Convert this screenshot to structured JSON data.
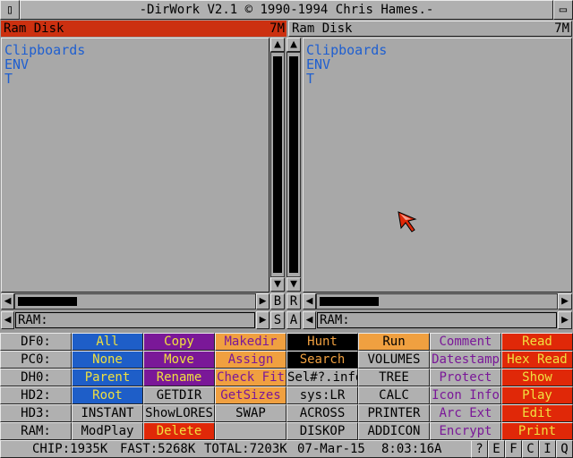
{
  "window": {
    "title": "-DirWork V2.1 © 1990-1994 Chris Hames.-",
    "left_gadget": "▯",
    "right_gadget": "▭"
  },
  "left": {
    "header": "Ram Disk",
    "size": "7M",
    "files": [
      "Clipboards",
      "ENV",
      "T"
    ],
    "path": "RAM:",
    "header_color": "#cc3010"
  },
  "right": {
    "header": "Ram Disk",
    "size": "7M",
    "files": [
      "Clipboards",
      "ENV",
      "T"
    ],
    "path": "RAM:"
  },
  "middle": {
    "b": "B",
    "r": "R",
    "s": "S",
    "a": "A"
  },
  "buttons": [
    [
      {
        "label": "DF0:",
        "bg": "#b0b0b0",
        "fg": "#000000"
      },
      {
        "label": "All",
        "bg": "#1e5ec8",
        "fg": "#f0e040"
      },
      {
        "label": "Copy",
        "bg": "#7a1898",
        "fg": "#f0e040"
      },
      {
        "label": "Makedir",
        "bg": "#f0a040",
        "fg": "#7a1898"
      },
      {
        "label": "Hunt",
        "bg": "#000000",
        "fg": "#f0a040"
      },
      {
        "label": "Run",
        "bg": "#f0a040",
        "fg": "#000000"
      },
      {
        "label": "Comment",
        "bg": "#b0b0b0",
        "fg": "#7a1898"
      },
      {
        "label": "Read",
        "bg": "#e02808",
        "fg": "#f0e040"
      }
    ],
    [
      {
        "label": "PC0:",
        "bg": "#b0b0b0",
        "fg": "#000000"
      },
      {
        "label": "None",
        "bg": "#1e5ec8",
        "fg": "#f0e040"
      },
      {
        "label": "Move",
        "bg": "#7a1898",
        "fg": "#f0e040"
      },
      {
        "label": "Assign",
        "bg": "#f0a040",
        "fg": "#7a1898"
      },
      {
        "label": "Search",
        "bg": "#000000",
        "fg": "#f0a040"
      },
      {
        "label": "VOLUMES",
        "bg": "#b0b0b0",
        "fg": "#000000"
      },
      {
        "label": "Datestamp",
        "bg": "#b0b0b0",
        "fg": "#7a1898"
      },
      {
        "label": "Hex Read",
        "bg": "#e02808",
        "fg": "#f0e040"
      }
    ],
    [
      {
        "label": "DH0:",
        "bg": "#b0b0b0",
        "fg": "#000000"
      },
      {
        "label": "Parent",
        "bg": "#1e5ec8",
        "fg": "#f0e040"
      },
      {
        "label": "Rename",
        "bg": "#7a1898",
        "fg": "#f0e040"
      },
      {
        "label": "Check Fit",
        "bg": "#f0a040",
        "fg": "#7a1898"
      },
      {
        "label": "Sel#?.info",
        "bg": "#b0b0b0",
        "fg": "#000000"
      },
      {
        "label": "TREE",
        "bg": "#b0b0b0",
        "fg": "#000000"
      },
      {
        "label": "Protect",
        "bg": "#b0b0b0",
        "fg": "#7a1898"
      },
      {
        "label": "Show",
        "bg": "#e02808",
        "fg": "#f0e040"
      }
    ],
    [
      {
        "label": "HD2:",
        "bg": "#b0b0b0",
        "fg": "#000000"
      },
      {
        "label": "Root",
        "bg": "#1e5ec8",
        "fg": "#f0e040"
      },
      {
        "label": "GETDIR",
        "bg": "#b0b0b0",
        "fg": "#000000"
      },
      {
        "label": "GetSizes",
        "bg": "#f0a040",
        "fg": "#7a1898"
      },
      {
        "label": "sys:LR",
        "bg": "#b0b0b0",
        "fg": "#000000"
      },
      {
        "label": "CALC",
        "bg": "#b0b0b0",
        "fg": "#000000"
      },
      {
        "label": "Icon Info",
        "bg": "#b0b0b0",
        "fg": "#7a1898"
      },
      {
        "label": "Play",
        "bg": "#e02808",
        "fg": "#f0e040"
      }
    ],
    [
      {
        "label": "HD3:",
        "bg": "#b0b0b0",
        "fg": "#000000"
      },
      {
        "label": "INSTANT",
        "bg": "#b0b0b0",
        "fg": "#000000"
      },
      {
        "label": "ShowLORES",
        "bg": "#b0b0b0",
        "fg": "#000000"
      },
      {
        "label": "SWAP",
        "bg": "#b0b0b0",
        "fg": "#000000"
      },
      {
        "label": "ACROSS",
        "bg": "#b0b0b0",
        "fg": "#000000"
      },
      {
        "label": "PRINTER",
        "bg": "#b0b0b0",
        "fg": "#000000"
      },
      {
        "label": "Arc Ext",
        "bg": "#b0b0b0",
        "fg": "#7a1898"
      },
      {
        "label": "Edit",
        "bg": "#e02808",
        "fg": "#f0e040"
      }
    ],
    [
      {
        "label": "RAM:",
        "bg": "#b0b0b0",
        "fg": "#000000"
      },
      {
        "label": "ModPlay",
        "bg": "#b0b0b0",
        "fg": "#000000"
      },
      {
        "label": "Delete",
        "bg": "#e02808",
        "fg": "#f0e040"
      },
      {
        "label": "",
        "bg": "#b0b0b0",
        "fg": "#000000"
      },
      {
        "label": "DISKOP",
        "bg": "#b0b0b0",
        "fg": "#000000"
      },
      {
        "label": "ADDICON",
        "bg": "#b0b0b0",
        "fg": "#000000"
      },
      {
        "label": "Encrypt",
        "bg": "#b0b0b0",
        "fg": "#7a1898"
      },
      {
        "label": "Print",
        "bg": "#e02808",
        "fg": "#f0e040"
      }
    ]
  ],
  "status": {
    "chip": "CHIP:1935K",
    "fast": "FAST:5268K",
    "total": "TOTAL:7203K",
    "date": "07-Mar-15",
    "time": "8:03:16A",
    "gadgets": [
      "?",
      "E",
      "F",
      "C",
      "I",
      "Q"
    ]
  }
}
